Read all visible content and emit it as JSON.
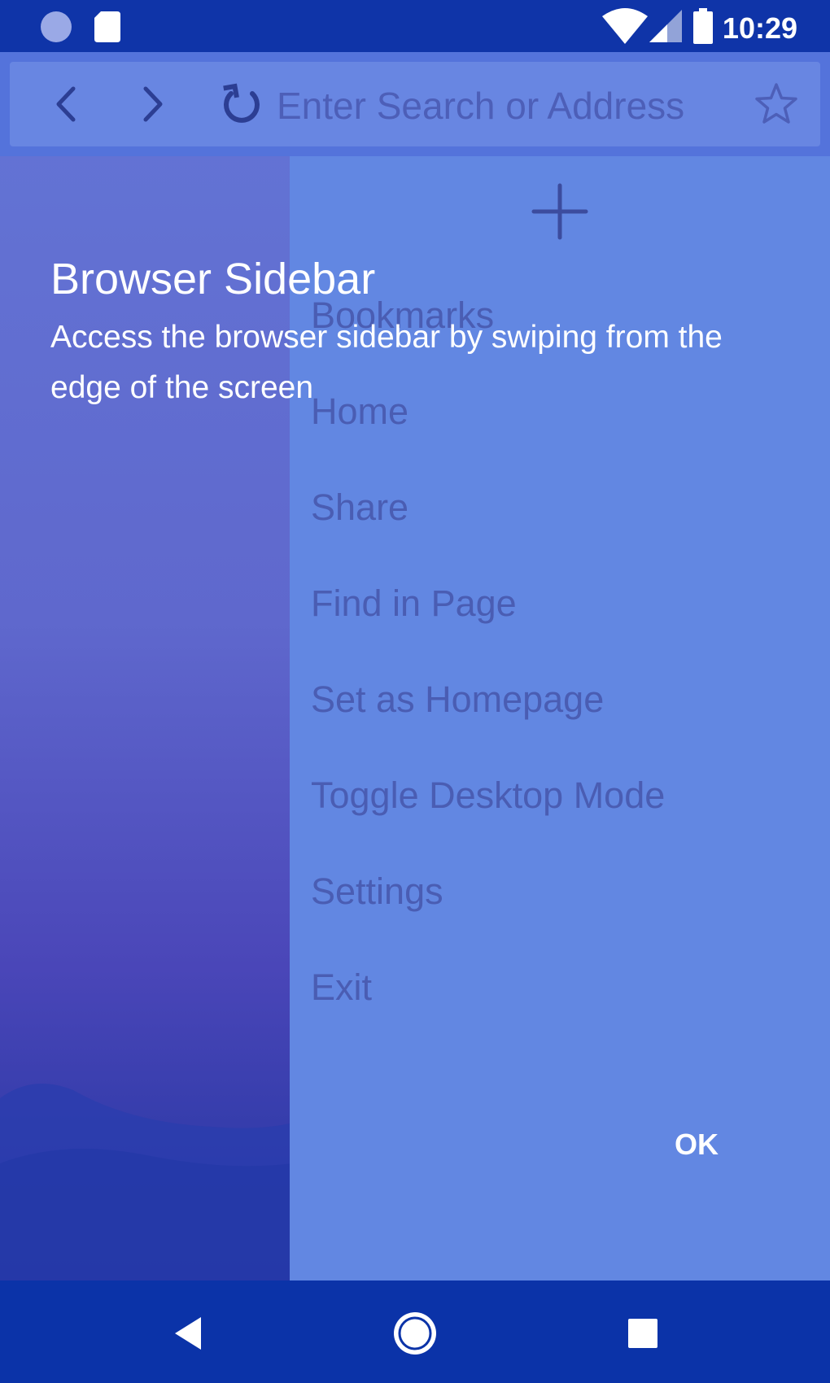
{
  "status_bar": {
    "time": "10:29",
    "icons": [
      "notification-dot-icon",
      "sd-card-icon",
      "wifi-icon",
      "signal-icon",
      "battery-icon"
    ]
  },
  "toolbar": {
    "back_icon": "chevron-left-icon",
    "forward_icon": "chevron-right-icon",
    "reload_icon": "reload-icon",
    "search_placeholder": "Enter Search or Address",
    "bookmark_icon": "star-outline-icon"
  },
  "sidebar": {
    "add_icon": "plus-icon",
    "items": [
      {
        "label": "Bookmarks"
      },
      {
        "label": "Home"
      },
      {
        "label": "Share"
      },
      {
        "label": "Find in Page"
      },
      {
        "label": "Set as Homepage"
      },
      {
        "label": "Toggle Desktop Mode"
      },
      {
        "label": "Settings"
      },
      {
        "label": "Exit"
      }
    ],
    "ok_label": "OK"
  },
  "tutorial": {
    "title": "Browser Sidebar",
    "description": "Access the browser sidebar by swiping from the edge of the screen"
  },
  "nav_bar": {
    "icons": [
      "back-triangle-icon",
      "home-circle-icon",
      "recents-square-icon"
    ]
  },
  "colors": {
    "status_bar": "#0f34a8",
    "toolbar": "#5473db",
    "sidebar": "#6287e2",
    "menu_text": "#4a5db3",
    "nav_bar": "#0b33a8"
  }
}
